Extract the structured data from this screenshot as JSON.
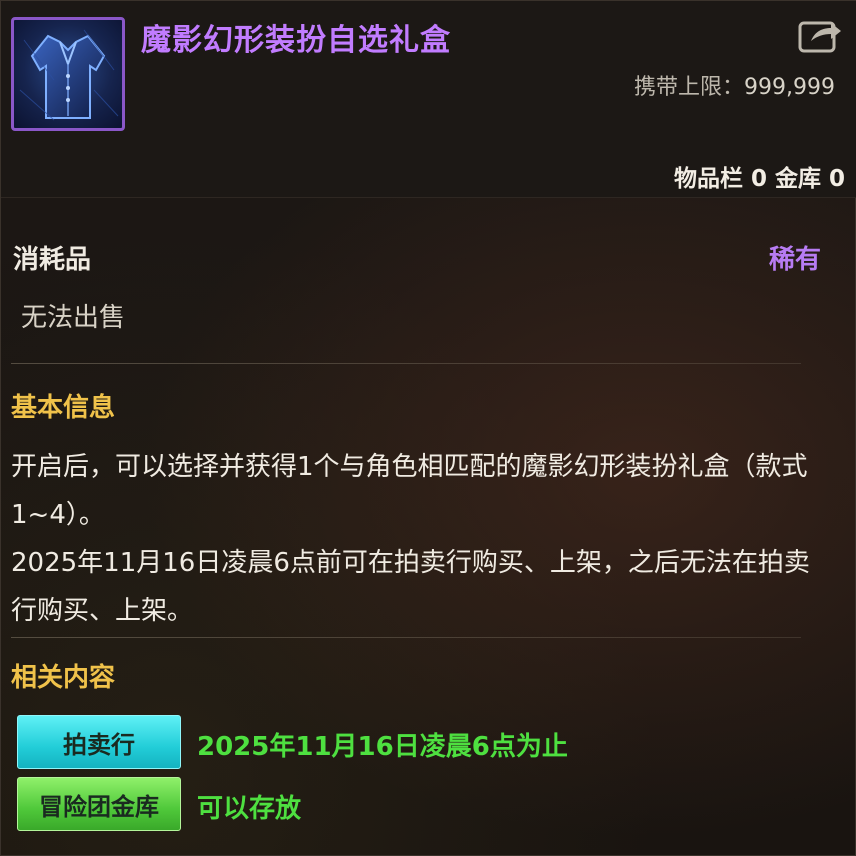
{
  "item": {
    "name": "魔影幻形装扮自选礼盒",
    "icon": "shirt-icon",
    "carry_limit_label": "携带上限：",
    "carry_limit_value": "999,999",
    "storage_text": "物品栏 0 金库 0"
  },
  "meta": {
    "category": "消耗品",
    "rarity": "稀有",
    "sell_status": "无法出售"
  },
  "basic_info": {
    "title": "基本信息",
    "lines": [
      "开启后，可以选择并获得1个与角色相匹配的魔影幻形装扮礼盒（款式1~4）。",
      "2025年11月16日凌晨6点前可在拍卖行购买、上架，之后无法在拍卖行购买、上架。"
    ]
  },
  "related": {
    "title": "相关内容",
    "entries": [
      {
        "tag": "拍卖行",
        "text": "2025年11月16日凌晨6点为止"
      },
      {
        "tag": "冒险团金库",
        "text": "可以存放"
      }
    ]
  },
  "colors": {
    "item_name": "#c17cff",
    "rarity": "#b77cf3",
    "section_title": "#f0c24a",
    "auction_tag": "#22cdd8",
    "vault_tag": "#4fc83a",
    "related_text": "#4ee040"
  }
}
